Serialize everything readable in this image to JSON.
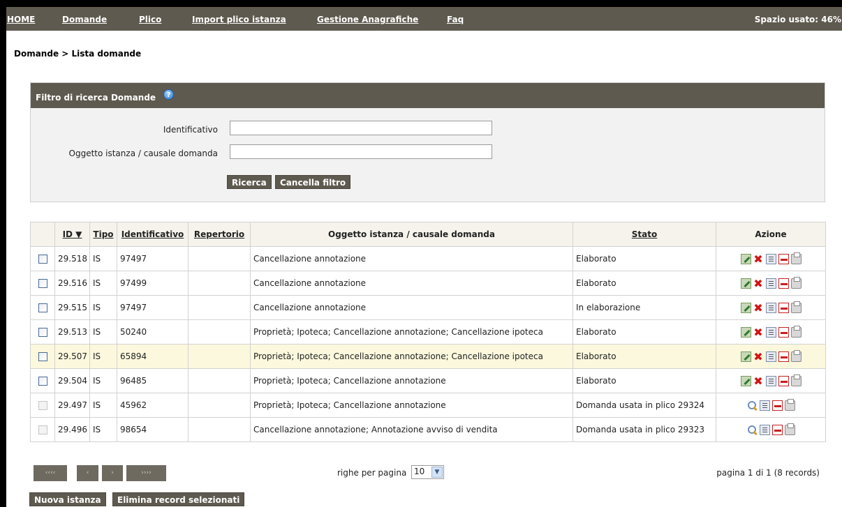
{
  "nav": {
    "items": [
      {
        "label": "HOME"
      },
      {
        "label": "Domande"
      },
      {
        "label": "Plico"
      },
      {
        "label": "Import plico istanza"
      },
      {
        "label": "Gestione Anagrafiche"
      },
      {
        "label": "Faq"
      }
    ],
    "space_used": "Spazio usato: 46%"
  },
  "breadcrumb": "Domande > Lista domande",
  "filter": {
    "title": "Filtro di ricerca Domande",
    "help_icon": "?",
    "identificativo_label": "Identificativo",
    "identificativo_value": "",
    "oggetto_label": "Oggetto istanza / causale domanda",
    "oggetto_value": "",
    "search_button": "Ricerca",
    "clear_button": "Cancella filtro"
  },
  "table": {
    "headers": {
      "id": "ID ▼",
      "tipo": "Tipo",
      "identificativo": "Identificativo",
      "repertorio": "Repertorio",
      "oggetto": "Oggetto istanza / causale domanda",
      "stato": "Stato",
      "azione": "Azione"
    },
    "rows": [
      {
        "id": "29.518",
        "tipo": "IS",
        "identificativo": "97497",
        "repertorio": "",
        "oggetto": "Cancellazione annotazione",
        "stato": "Elaborato"
      },
      {
        "id": "29.516",
        "tipo": "IS",
        "identificativo": "97499",
        "repertorio": "",
        "oggetto": "Cancellazione annotazione",
        "stato": "Elaborato"
      },
      {
        "id": "29.515",
        "tipo": "IS",
        "identificativo": "97497",
        "repertorio": "",
        "oggetto": "Cancellazione annotazione",
        "stato": "In elaborazione"
      },
      {
        "id": "29.513",
        "tipo": "IS",
        "identificativo": "50240",
        "repertorio": "",
        "oggetto": "Proprietà; Ipoteca; Cancellazione annotazione; Cancellazione ipoteca",
        "stato": "Elaborato"
      },
      {
        "id": "29.507",
        "tipo": "IS",
        "identificativo": "65894",
        "repertorio": "",
        "oggetto": "Proprietà; Ipoteca; Cancellazione annotazione; Cancellazione ipoteca",
        "stato": "Elaborato"
      },
      {
        "id": "29.504",
        "tipo": "IS",
        "identificativo": "96485",
        "repertorio": "",
        "oggetto": "Proprietà; Ipoteca; Cancellazione annotazione",
        "stato": "Elaborato"
      },
      {
        "id": "29.497",
        "tipo": "IS",
        "identificativo": "45962",
        "repertorio": "",
        "oggetto": "Proprietà; Ipoteca; Cancellazione annotazione",
        "stato": "Domanda usata in plico 29324"
      },
      {
        "id": "29.496",
        "tipo": "IS",
        "identificativo": "98654",
        "repertorio": "",
        "oggetto": "Cancellazione annotazione; Annotazione avviso di vendita",
        "stato": "Domanda usata in plico 29323"
      }
    ]
  },
  "pagination": {
    "first": "‹‹‹‹",
    "prev": "‹",
    "next": "›",
    "last": "››››",
    "rows_label": "righe per pagina",
    "rows_value": "10",
    "page_info": "pagina 1 di 1 (8 records)"
  },
  "actions": {
    "new_button": "Nuova istanza",
    "delete_button": "Elimina record selezionati"
  }
}
